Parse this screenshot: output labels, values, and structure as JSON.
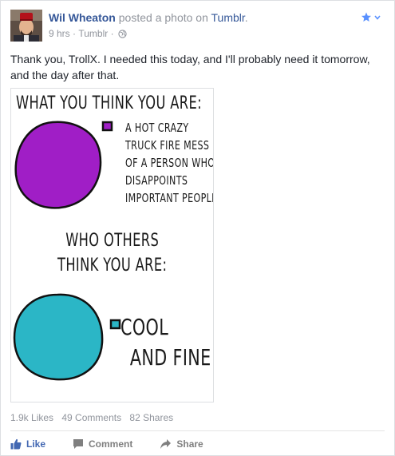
{
  "post": {
    "author": "Wil Wheaton",
    "action_text": "posted a photo on",
    "source": "Tumblr",
    "time": "9 hrs",
    "via": "Tumblr",
    "text": "Thank you, TrollX. I needed this today, and I'll probably need it tomorrow, and the day after that."
  },
  "comic": {
    "title": "What you think you are:",
    "option1": [
      "A hot crazy",
      "truck fire mess",
      "of a person who",
      "disappoints",
      "important people"
    ],
    "subtitle": [
      "Who others",
      "think you are:"
    ],
    "option2": [
      "Cool",
      "and fine"
    ],
    "colors": {
      "purple": "#a01ec6",
      "teal": "#2bb6c6"
    }
  },
  "stats": {
    "likes": "1.9k Likes",
    "comments": "49 Comments",
    "shares": "82 Shares"
  },
  "actions": {
    "like": "Like",
    "comment": "Comment",
    "share": "Share"
  },
  "icons": [
    "star-icon",
    "globe-icon",
    "like-icon",
    "comment-icon",
    "share-icon"
  ]
}
